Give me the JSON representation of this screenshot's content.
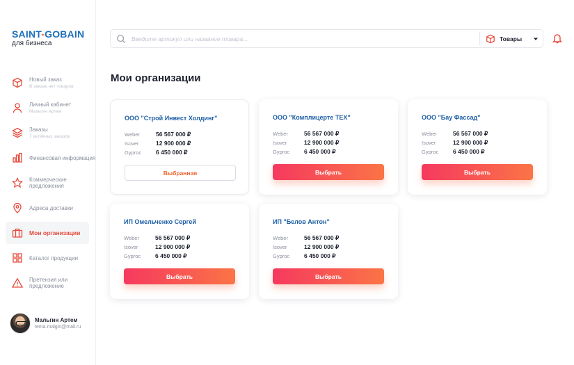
{
  "brand": {
    "name_part1": "SAINT",
    "dash": "-",
    "name_part2": "GOBAIN",
    "subtitle": "для бизнеса"
  },
  "nav": [
    {
      "label": "Новый заказ",
      "sub": "В заказе нет товаров",
      "icon": "box-icon"
    },
    {
      "label": "Личный кабинет",
      "sub": "Мальгин Артем",
      "icon": "user-icon"
    },
    {
      "label": "Заказы",
      "sub": "7 активных заказов",
      "icon": "layers-icon"
    },
    {
      "label": "Финансовая информация",
      "sub": "",
      "icon": "bar-chart-icon"
    },
    {
      "label": "Коммерческие предложения",
      "sub": "",
      "icon": "star-icon"
    },
    {
      "label": "Адреса доставки",
      "sub": "",
      "icon": "map-pin-icon"
    },
    {
      "label": "Мои организации",
      "sub": "",
      "icon": "briefcase-icon",
      "active": true
    },
    {
      "label": "Каталог продукции",
      "sub": "",
      "icon": "grid-icon"
    },
    {
      "label": "Претензия или предложение",
      "sub": "",
      "icon": "warning-icon"
    }
  ],
  "user": {
    "name": "Мальгин Артем",
    "email": "tema.malgin@mail.ru"
  },
  "search": {
    "placeholder": "Введите артикул или название товара...",
    "value": ""
  },
  "category_select": {
    "selected": "Товары"
  },
  "page_title": "Мои организации",
  "orgs": [
    {
      "name": "ООО \"Строй Инвест Холдинг\"",
      "rows": [
        {
          "label": "Weber",
          "value": "56 567 000 ₽"
        },
        {
          "label": "Isover",
          "value": "12 900 000 ₽"
        },
        {
          "label": "Gyproc",
          "value": "6 450 000 ₽"
        }
      ],
      "button": "Выбранная",
      "selected": true
    },
    {
      "name": "ООО \"Комплицерте ТЕХ\"",
      "rows": [
        {
          "label": "Weber",
          "value": "56 567 000 ₽"
        },
        {
          "label": "Isover",
          "value": "12 900 000 ₽"
        },
        {
          "label": "Gyproc",
          "value": "6 450 000 ₽"
        }
      ],
      "button": "Выбрать"
    },
    {
      "name": "ООО \"Бау Фассад\"",
      "rows": [
        {
          "label": "Weber",
          "value": "56 567 000 ₽"
        },
        {
          "label": "Isover",
          "value": "12 900 000 ₽"
        },
        {
          "label": "Gyproc",
          "value": "6 450 000 ₽"
        }
      ],
      "button": "Выбрать"
    },
    {
      "name": "ИП Омельченко Сергей",
      "rows": [
        {
          "label": "Weber",
          "value": "56 567 000 ₽"
        },
        {
          "label": "Isover",
          "value": "12 900 000 ₽"
        },
        {
          "label": "Gyproc",
          "value": "6 450 000 ₽"
        }
      ],
      "button": "Выбрать"
    },
    {
      "name": "ИП \"Белов Антон\"",
      "rows": [
        {
          "label": "Weber",
          "value": "56 567 000 ₽"
        },
        {
          "label": "Isover",
          "value": "12 900 000 ₽"
        },
        {
          "label": "Gyproc",
          "value": "6 450 000 ₽"
        }
      ],
      "button": "Выбрать"
    }
  ],
  "colors": {
    "accent": "#e64a3b",
    "brand_blue": "#1d6fb8",
    "org_title": "#1d5fa6",
    "gradient_start": "#f5395f",
    "gradient_end": "#fb7446"
  }
}
